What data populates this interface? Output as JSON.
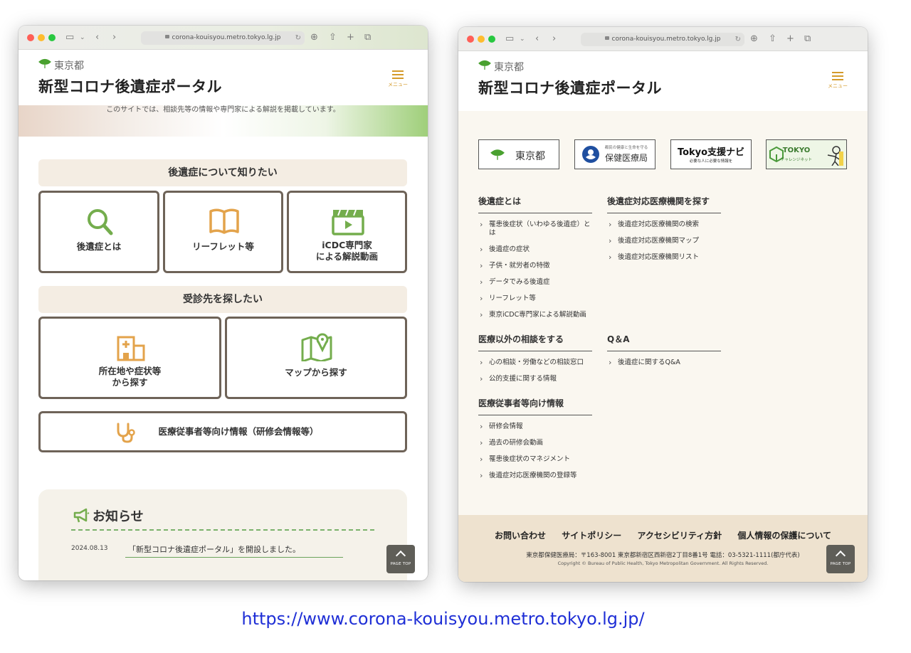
{
  "browser": {
    "url": "corona-kouisyou.metro.tokyo.lg.jp"
  },
  "site": {
    "org": "東京都",
    "title": "新型コロナ後遺症ポータル",
    "menu_label": "メニュー"
  },
  "left": {
    "hero_text": "このサイトでは、相談先等の情報や専門家による解説を掲載しています。",
    "section1": "後遺症について知りたい",
    "cards1": [
      "後遺症とは",
      "リーフレット等",
      "iCDC専門家",
      "による解説動画"
    ],
    "section2": "受診先を探したい",
    "cards2": [
      "所在地や症状等",
      "から探す",
      "マップから探す"
    ],
    "wide_card": "医療従事者等向け情報（研修会情報等）",
    "notice": {
      "title": "お知らせ",
      "date": "2024.08.13",
      "text": "「新型コロナ後遺症ポータル」を開設しました。"
    },
    "pagetop": "PAGE TOP"
  },
  "right": {
    "logos": [
      "東京都",
      "保健医療局",
      "Tokyo支援ナビ",
      "TOKYO"
    ],
    "logo_sub": {
      "hokeniryo": "都民の健康と生命を守る",
      "navi": "必要な人に必要な情報を",
      "challenge": "チャレンジネット"
    },
    "columns": {
      "c1": {
        "heading": "後遺症とは",
        "items": [
          "罹患後症状（いわゆる後遺症）とは",
          "後遺症の症状",
          "子供・就労者の特徴",
          "データでみる後遺症",
          "リーフレット等",
          "東京iCDC専門家による解説動画"
        ]
      },
      "c2": {
        "heading": "後遺症対応医療機関を探す",
        "items": [
          "後遺症対応医療機関の検索",
          "後遺症対応医療機関マップ",
          "後遺症対応医療機関リスト"
        ]
      },
      "c3": {
        "heading": "医療以外の相談をする",
        "items": [
          "心の相談・労働などの相談窓口",
          "公的支援に関する情報"
        ]
      },
      "c4": {
        "heading": "Q＆A",
        "items": [
          "後遺症に関するQ&A"
        ]
      },
      "c5": {
        "heading": "医療従事者等向け情報",
        "items": [
          "研修会情報",
          "過去の研修会動画",
          "罹患後症状のマネジメント",
          "後遺症対応医療機関の登録等"
        ]
      }
    },
    "footer": {
      "links": [
        "お問い合わせ",
        "サイトポリシー",
        "アクセシビリティ方針",
        "個人情報の保護について"
      ],
      "address": "東京都保健医療局：〒163-8001 東京都新宿区西新宿2丁目8番1号 電話：03-5321-1111(都庁代表)",
      "copyright": "Copyright © Bureau of Public Health, Tokyo Metropolitan Government. All Rights Reserved."
    },
    "pagetop": "PAGE TOP"
  },
  "caption": "https://www.corona-kouisyou.metro.tokyo.lg.jp/"
}
